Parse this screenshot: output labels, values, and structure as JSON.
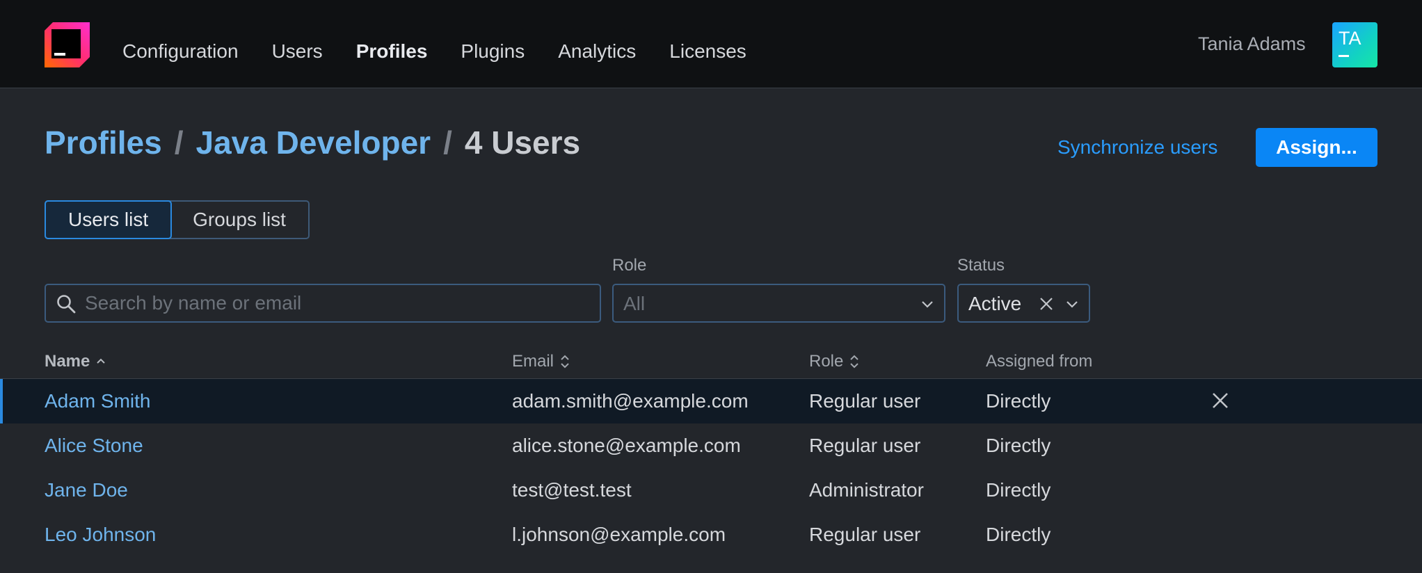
{
  "nav": {
    "items": [
      {
        "label": "Configuration",
        "active": false
      },
      {
        "label": "Users",
        "active": false
      },
      {
        "label": "Profiles",
        "active": true
      },
      {
        "label": "Plugins",
        "active": false
      },
      {
        "label": "Analytics",
        "active": false
      },
      {
        "label": "Licenses",
        "active": false
      }
    ],
    "user_name": "Tania Adams",
    "avatar_initials": "TA",
    "logo_icon": "jetbrains-logo-icon"
  },
  "breadcrumb": {
    "root": "Profiles",
    "sep1": "/",
    "profile": "Java Developer",
    "sep2": "/",
    "current": "4 Users"
  },
  "actions": {
    "sync_label": "Synchronize users",
    "assign_label": "Assign..."
  },
  "tabs": [
    {
      "label": "Users list",
      "active": true
    },
    {
      "label": "Groups list",
      "active": false
    }
  ],
  "filters": {
    "search_placeholder": "Search by name or email",
    "role_label": "Role",
    "role_value": "All",
    "status_label": "Status",
    "status_value": "Active"
  },
  "table": {
    "columns": {
      "name": "Name",
      "email": "Email",
      "role": "Role",
      "assigned": "Assigned from"
    },
    "rows": [
      {
        "name": "Adam Smith",
        "email": "adam.smith@example.com",
        "role": "Regular user",
        "assigned": "Directly",
        "selected": true
      },
      {
        "name": "Alice Stone",
        "email": "alice.stone@example.com",
        "role": "Regular user",
        "assigned": "Directly",
        "selected": false
      },
      {
        "name": "Jane Doe",
        "email": "test@test.test",
        "role": "Administrator",
        "assigned": "Directly",
        "selected": false
      },
      {
        "name": "Leo Johnson",
        "email": "l.johnson@example.com",
        "role": "Regular user",
        "assigned": "Directly",
        "selected": false
      }
    ]
  },
  "colors": {
    "accent": "#0a86f5",
    "link": "#6fb4ec",
    "background": "#23262b",
    "topbar": "#0f1113"
  }
}
